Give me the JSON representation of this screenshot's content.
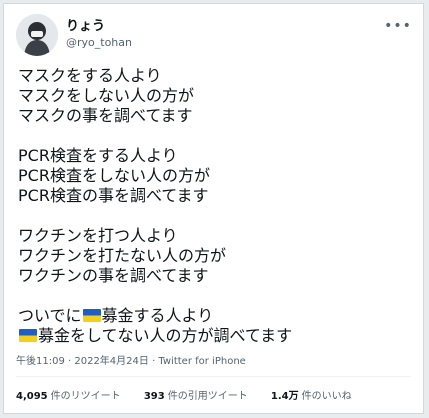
{
  "header": {
    "display_name": "りょう",
    "handle": "@ryo_tohan"
  },
  "tweet": {
    "paragraphs": [
      [
        "マスクをする人より",
        "マスクをしない人の方が",
        "マスクの事を調べてます"
      ],
      [
        "PCR検査をする人より",
        "PCR検査をしない人の方が",
        "PCR検査の事を調べてます"
      ],
      [
        "ワクチンを打つ人より",
        "ワクチンを打たない人の方が",
        "ワクチンの事を調べてます"
      ]
    ],
    "last_line1_prefix": "ついでに",
    "last_line1_suffix": "募金する人より",
    "last_line2_suffix": "募金をしてない人の方が調べてます",
    "flag_icon": "ukraine-flag-icon"
  },
  "meta": {
    "text": "午後11:09 · 2022年4月24日 · Twitter for iPhone"
  },
  "stats": {
    "retweets_count": "4,095",
    "retweets_label": "件のリツイート",
    "quotes_count": "393",
    "quotes_label": "件の引用ツイート",
    "likes_count": "1.4万",
    "likes_label": "件のいいね"
  },
  "colors": {
    "text": "#0f1419",
    "secondary": "#536471",
    "flag_blue": "#1f5fbf",
    "flag_yellow": "#f6cf1d"
  }
}
